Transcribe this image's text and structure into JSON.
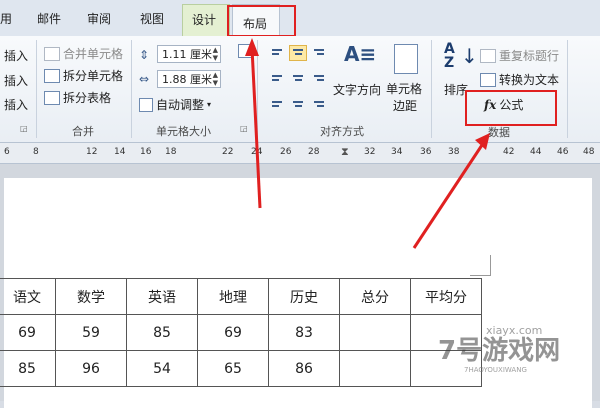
{
  "tabs": {
    "partial": "用",
    "mail": "邮件",
    "review": "审阅",
    "view": "视图",
    "design": "设计",
    "layout": "布局"
  },
  "ribbon": {
    "insert_above": "插入",
    "insert_left": "插入",
    "insert_right": "插入",
    "merge_cells": "合并单元格",
    "split_cells": "拆分单元格",
    "split_table": "拆分表格",
    "merge_group": "合并",
    "height_value": "1.11 厘米",
    "width_value": "1.88 厘米",
    "autofit": "自动调整",
    "cell_size_group": "单元格大小",
    "text_direction": "文字方向",
    "cell_margins_1": "单元格",
    "cell_margins_2": "边距",
    "align_group": "对齐方式",
    "sort": "排序",
    "repeat_header": "重复标题行",
    "convert_to_text": "转换为文本",
    "formula": "公式",
    "data_group": "数据"
  },
  "ruler": [
    "6",
    "8",
    "12",
    "14",
    "16",
    "18",
    "22",
    "24",
    "26",
    "28",
    "32",
    "34",
    "36",
    "38",
    "42",
    "44",
    "46",
    "48"
  ],
  "table": {
    "headers": [
      "语文",
      "数学",
      "英语",
      "地理",
      "历史",
      "总分",
      "平均分"
    ],
    "rows": [
      [
        "69",
        "59",
        "85",
        "69",
        "83",
        "",
        ""
      ],
      [
        "85",
        "96",
        "54",
        "65",
        "86",
        "",
        ""
      ]
    ]
  },
  "watermark": {
    "brand": "7号游戏网",
    "sub": "7HAOYOUXIWANG",
    "domain": "xiayx.com"
  },
  "colors": {
    "highlight": "#e02020",
    "arrow": "#e02020",
    "design_tab_bg": "#e4f0d2"
  }
}
